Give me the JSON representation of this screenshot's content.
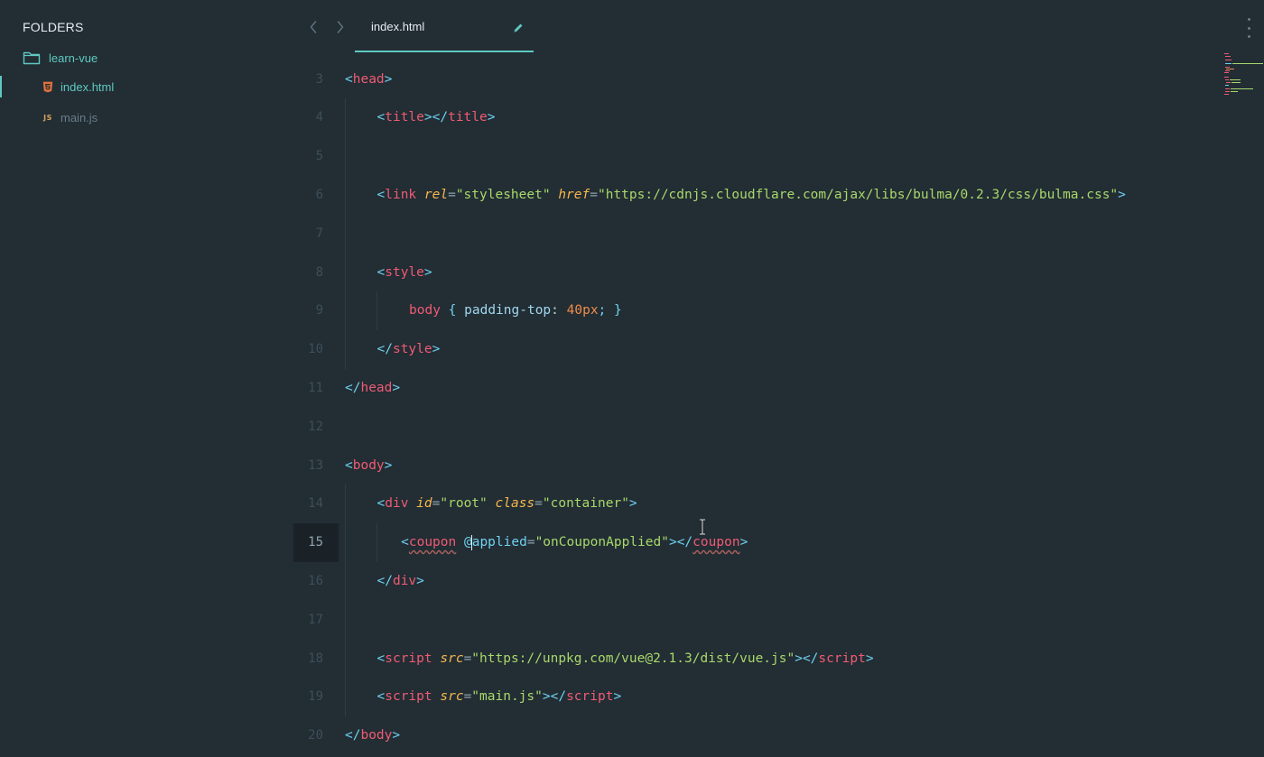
{
  "sidebar": {
    "title": "FOLDERS",
    "folder": {
      "name": "learn-vue",
      "icon": "folder-icon"
    },
    "files": [
      {
        "name": "index.html",
        "icon": "html5-file-icon",
        "active": true
      },
      {
        "name": "main.js",
        "icon": "js-file-icon",
        "badge": "JS",
        "active": false
      }
    ]
  },
  "tabbar": {
    "back_icon": "chevron-left-icon",
    "forward_icon": "chevron-right-icon",
    "tab": {
      "label": "index.html",
      "icon": "pencil-icon"
    },
    "menu_icon": "vertical-dots-icon"
  },
  "colors": {
    "background": "#222d34",
    "accent": "#5fc9c0",
    "tag": "#ef5b73",
    "bracket": "#6fd1ef",
    "attribute": "#f6b84c",
    "string": "#a9d86a",
    "number": "#f08d49",
    "line_number": "#3e4f59"
  },
  "editor": {
    "current_line": 15,
    "lines": [
      {
        "n": "3",
        "tokens": [
          {
            "t": "<",
            "c": "br"
          },
          {
            "t": "head",
            "c": "tag"
          },
          {
            "t": ">",
            "c": "br"
          }
        ]
      },
      {
        "n": "4",
        "tokens": [
          {
            "t": "<",
            "c": "br"
          },
          {
            "t": "title",
            "c": "tag"
          },
          {
            "t": "></",
            "c": "br"
          },
          {
            "t": "title",
            "c": "tag"
          },
          {
            "t": ">",
            "c": "br"
          }
        ]
      },
      {
        "n": "5",
        "tokens": []
      },
      {
        "n": "6",
        "tokens": [
          {
            "t": "<",
            "c": "br"
          },
          {
            "t": "link",
            "c": "tag"
          },
          {
            "t": " ",
            "c": "txt"
          },
          {
            "t": "rel",
            "c": "attr"
          },
          {
            "t": "=",
            "c": "eq"
          },
          {
            "t": "\"stylesheet\"",
            "c": "str"
          },
          {
            "t": " ",
            "c": "txt"
          },
          {
            "t": "href",
            "c": "attr"
          },
          {
            "t": "=",
            "c": "eq"
          },
          {
            "t": "\"https://cdnjs.cloudflare.com/ajax/libs/bulma/0.2.3/css/bulma.css\"",
            "c": "str"
          },
          {
            "t": ">",
            "c": "br"
          }
        ]
      },
      {
        "n": "7",
        "tokens": []
      },
      {
        "n": "8",
        "tokens": [
          {
            "t": "<",
            "c": "br"
          },
          {
            "t": "style",
            "c": "tag"
          },
          {
            "t": ">",
            "c": "br"
          }
        ]
      },
      {
        "n": "9",
        "tokens": [
          {
            "t": "body",
            "c": "sel"
          },
          {
            "t": " { ",
            "c": "br"
          },
          {
            "t": "padding-top",
            "c": "prop"
          },
          {
            "t": ": ",
            "c": "txt"
          },
          {
            "t": "40px",
            "c": "num"
          },
          {
            "t": "; }",
            "c": "br"
          }
        ]
      },
      {
        "n": "10",
        "tokens": [
          {
            "t": "</",
            "c": "br"
          },
          {
            "t": "style",
            "c": "tag"
          },
          {
            "t": ">",
            "c": "br"
          }
        ]
      },
      {
        "n": "11",
        "tokens": [
          {
            "t": "</",
            "c": "br"
          },
          {
            "t": "head",
            "c": "tag"
          },
          {
            "t": ">",
            "c": "br"
          }
        ]
      },
      {
        "n": "12",
        "tokens": []
      },
      {
        "n": "13",
        "tokens": [
          {
            "t": "<",
            "c": "br"
          },
          {
            "t": "body",
            "c": "tag"
          },
          {
            "t": ">",
            "c": "br"
          }
        ]
      },
      {
        "n": "14",
        "tokens": [
          {
            "t": "<",
            "c": "br"
          },
          {
            "t": "div",
            "c": "tag"
          },
          {
            "t": " ",
            "c": "txt"
          },
          {
            "t": "id",
            "c": "attr"
          },
          {
            "t": "=",
            "c": "eq"
          },
          {
            "t": "\"root\"",
            "c": "str"
          },
          {
            "t": " ",
            "c": "txt"
          },
          {
            "t": "class",
            "c": "attr"
          },
          {
            "t": "=",
            "c": "eq"
          },
          {
            "t": "\"container\"",
            "c": "str"
          },
          {
            "t": ">",
            "c": "br"
          }
        ]
      },
      {
        "n": "15",
        "tokens": [
          {
            "t": "<",
            "c": "br"
          },
          {
            "t": "coupon",
            "c": "tag squig"
          },
          {
            "t": " ",
            "c": "txt"
          },
          {
            "t": "@",
            "c": "attr2"
          },
          {
            "t": "CARET",
            "c": "caret"
          },
          {
            "t": "applied",
            "c": "attr2"
          },
          {
            "t": "=",
            "c": "eq"
          },
          {
            "t": "\"onCouponApplied\"",
            "c": "str"
          },
          {
            "t": "></",
            "c": "br"
          },
          {
            "t": "coupon",
            "c": "tag squig"
          },
          {
            "t": ">",
            "c": "br"
          }
        ]
      },
      {
        "n": "16",
        "tokens": [
          {
            "t": "</",
            "c": "br"
          },
          {
            "t": "div",
            "c": "tag"
          },
          {
            "t": ">",
            "c": "br"
          }
        ]
      },
      {
        "n": "17",
        "tokens": []
      },
      {
        "n": "18",
        "tokens": [
          {
            "t": "<",
            "c": "br"
          },
          {
            "t": "script",
            "c": "tag"
          },
          {
            "t": " ",
            "c": "txt"
          },
          {
            "t": "src",
            "c": "attr"
          },
          {
            "t": "=",
            "c": "eq"
          },
          {
            "t": "\"https://unpkg.com/vue@2.1.3/dist/vue.js\"",
            "c": "str"
          },
          {
            "t": "></",
            "c": "br"
          },
          {
            "t": "script",
            "c": "tag"
          },
          {
            "t": ">",
            "c": "br"
          }
        ]
      },
      {
        "n": "19",
        "tokens": [
          {
            "t": "<",
            "c": "br"
          },
          {
            "t": "script",
            "c": "tag"
          },
          {
            "t": " ",
            "c": "txt"
          },
          {
            "t": "src",
            "c": "attr"
          },
          {
            "t": "=",
            "c": "eq"
          },
          {
            "t": "\"main.js\"",
            "c": "str"
          },
          {
            "t": "></",
            "c": "br"
          },
          {
            "t": "script",
            "c": "tag"
          },
          {
            "t": ">",
            "c": "br"
          }
        ]
      },
      {
        "n": "20",
        "tokens": [
          {
            "t": "</",
            "c": "br"
          },
          {
            "t": "body",
            "c": "tag"
          },
          {
            "t": ">",
            "c": "br"
          }
        ]
      }
    ]
  }
}
